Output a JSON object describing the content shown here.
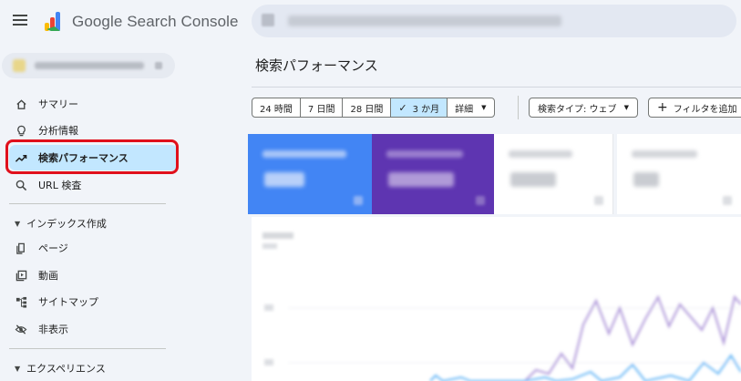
{
  "header": {
    "app_title": "Google Search Console",
    "search_value": "blurred"
  },
  "property": {
    "name": "blurred"
  },
  "sidebar": {
    "items": [
      {
        "label": "サマリー",
        "icon": "home-icon"
      },
      {
        "label": "分析情報",
        "icon": "lightbulb-icon"
      },
      {
        "label": "検索パフォーマンス",
        "icon": "trending-up-icon",
        "active": true
      },
      {
        "label": "URL 検査",
        "icon": "search-icon"
      }
    ],
    "indexing_section": {
      "label": "インデックス作成",
      "items": [
        {
          "label": "ページ",
          "icon": "pages-icon"
        },
        {
          "label": "動画",
          "icon": "video-icon"
        },
        {
          "label": "サイトマップ",
          "icon": "sitemap-icon"
        },
        {
          "label": "非表示",
          "icon": "eye-off-icon"
        }
      ]
    },
    "experience_section": {
      "label": "エクスペリエンス"
    }
  },
  "main": {
    "page_title": "検索パフォーマンス",
    "date_ranges": [
      "24 時間",
      "7 日間",
      "28 日間",
      "3 か月"
    ],
    "selected_range": "3 か月",
    "detail_label": "詳細",
    "search_type_label": "検索タイプ: ウェブ",
    "add_filter_label": "フィルタを追加"
  },
  "colors": {
    "accent_blue": "#4285f4",
    "accent_purple": "#5e35b1",
    "active_nav": "#c2e7ff",
    "highlight_red": "#e0101c",
    "chart_line_purple": "#b39ddb",
    "chart_line_blue": "#64b5f6"
  }
}
